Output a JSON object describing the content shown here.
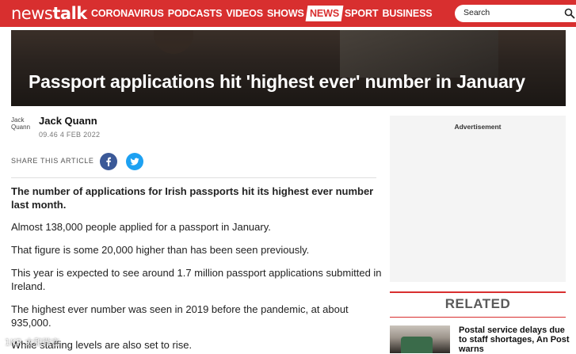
{
  "header": {
    "logo": {
      "part1": "news",
      "part2": "talk"
    },
    "nav": [
      {
        "label": "CORONAVIRUS",
        "active": false
      },
      {
        "label": "PODCASTS",
        "active": false
      },
      {
        "label": "VIDEOS",
        "active": false
      },
      {
        "label": "SHOWS",
        "active": false
      },
      {
        "label": "NEWS",
        "active": true
      },
      {
        "label": "SPORT",
        "active": false
      },
      {
        "label": "BUSINESS",
        "active": false
      }
    ],
    "search": {
      "placeholder": "Search",
      "icon": "search-icon"
    }
  },
  "article": {
    "title": "Passport applications hit 'highest ever' number in January",
    "author": {
      "name": "Jack Quann",
      "avatar_alt": "Jack Quann",
      "date": "09.46 4 FEB 2022"
    },
    "share": {
      "label": "SHARE THIS ARTICLE",
      "buttons": [
        "facebook-icon",
        "twitter-icon"
      ]
    },
    "lead": "The number of applications for Irish passports hit its highest ever number last month.",
    "paragraphs": [
      "Almost 138,000 people applied for a passport in January.",
      "That figure is some 20,000 higher than has been seen previously.",
      "This year is expected to see around 1.7 million passport applications submitted in Ireland.",
      "The highest ever number was seen in 2019 before the pandemic, at about 935,000.",
      "While staffing levels are also set to rise."
    ]
  },
  "sidebar": {
    "ad_label": "Advertisement",
    "related_title": "RELATED",
    "related_items": [
      {
        "title": "Postal service delays due to staff shortages, An Post warns"
      }
    ]
  },
  "watermark": "1KR 太和微言",
  "colors": {
    "brand": "#d82f2f",
    "facebook": "#3b5998",
    "twitter": "#1da1f2"
  }
}
